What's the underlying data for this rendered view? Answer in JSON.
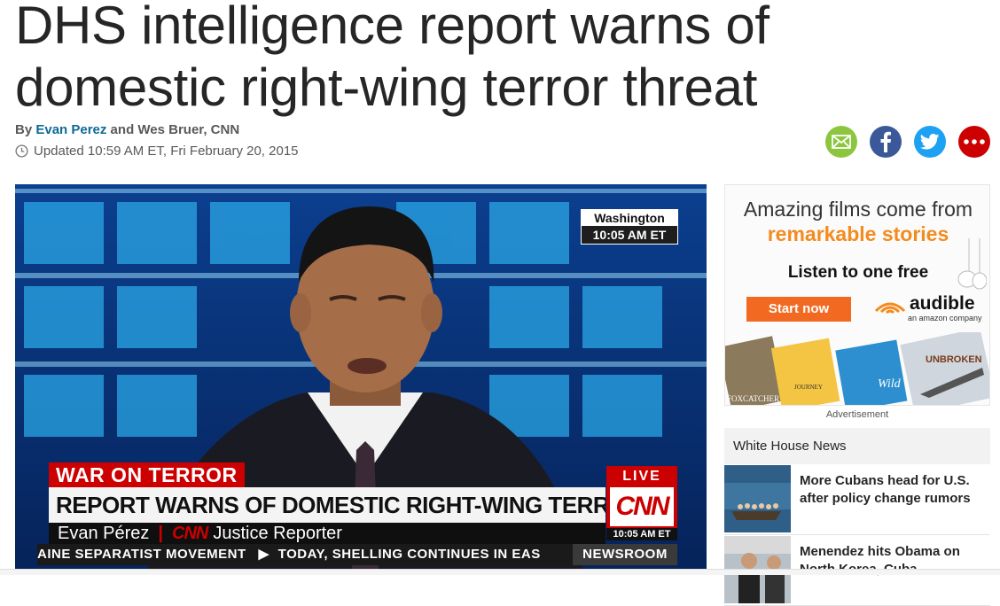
{
  "article": {
    "headline": "DHS intelligence report warns of domestic right-wing terror threat",
    "byline_prefix": "By ",
    "author1": "Evan Perez",
    "byline_and": " and Wes Bruer, CNN",
    "updated": "Updated 10:59 AM ET, Fri February 20, 2015"
  },
  "share": {
    "icons": [
      "email-icon",
      "facebook-icon",
      "twitter-icon",
      "more-icon"
    ],
    "colors": {
      "email": "#8cc63f",
      "facebook": "#3b5998",
      "twitter": "#1da1f2",
      "more": "#cc0000"
    }
  },
  "video": {
    "location": "Washington",
    "location_time": "10:05 AM ET",
    "topic": "WAR ON TERROR",
    "chyron": "REPORT WARNS OF DOMESTIC RIGHT-WING TERROR",
    "reporter_name": "Evan Pérez",
    "network": "CNN",
    "reporter_title": "Justice Reporter",
    "live": "LIVE",
    "logo": "CNN",
    "live_time": "10:05 AM ET",
    "ticker_left": "AINE SEPARATIST MOVEMENT",
    "ticker_right": "TODAY, SHELLING CONTINUES IN EAS",
    "show": "NEWSROOM"
  },
  "ad": {
    "line1": "Amazing films come from",
    "line2": "remarkable stories",
    "line3": "Listen to one free",
    "button": "Start now",
    "brand": "audible",
    "brand_sub": "an amazon company",
    "label": "Advertisement",
    "book_titles": [
      "FOXCATCHER",
      "JOURNEY",
      "Wild",
      "UNBROKEN"
    ]
  },
  "sidebar": {
    "section_title": "White House News",
    "stories": [
      {
        "title": "More Cubans head for U.S. after policy change rumors"
      },
      {
        "title": "Menendez hits Obama on North Korea, Cuba"
      }
    ]
  }
}
